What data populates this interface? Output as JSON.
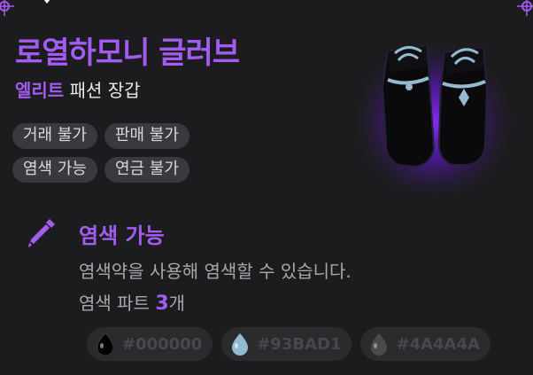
{
  "item": {
    "name": "로열하모니 글러브",
    "grade": "엘리트",
    "category": "패션 장갑"
  },
  "tags": [
    "거래 불가",
    "판매 불가",
    "염색 가능",
    "연금 불가"
  ],
  "dye": {
    "title": "염색 가능",
    "description": "염색약을 사용해 염색할 수 있습니다.",
    "parts_prefix": "염색 파트 ",
    "parts_count": "3",
    "parts_suffix": "개",
    "colors": [
      {
        "code": "#000000",
        "swatch": "#000000"
      },
      {
        "code": "#93BAD1",
        "swatch": "#93BAD1"
      },
      {
        "code": "#4A4A4A",
        "swatch": "#4A4A4A"
      }
    ]
  },
  "theme": {
    "accent": "#a35cf2",
    "background": "#1c1c1e",
    "tag_bg": "#3a3a3e"
  },
  "icons": {
    "dye": "dye-dropper-icon",
    "corner": "corner-ornament-icon",
    "pointer": "pointer-arrow-icon"
  }
}
